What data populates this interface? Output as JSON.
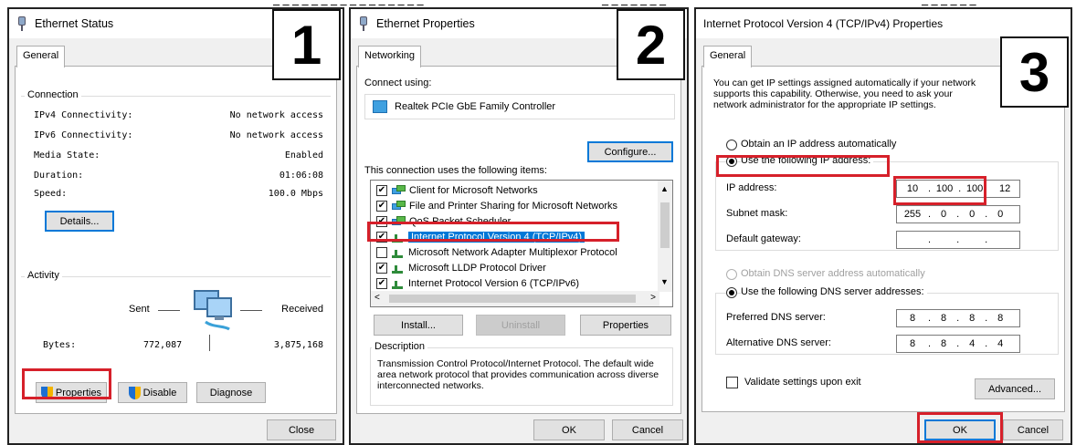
{
  "panels": {
    "status": {
      "window_title": "Ethernet Status",
      "step_number": "1",
      "tab": "General",
      "connection_group": "Connection",
      "rows": [
        {
          "label": "IPv4 Connectivity:",
          "value": "No network access"
        },
        {
          "label": "IPv6 Connectivity:",
          "value": "No network access"
        },
        {
          "label": "Media State:",
          "value": "Enabled"
        },
        {
          "label": "Duration:",
          "value": "01:06:08"
        },
        {
          "label": "Speed:",
          "value": "100.0 Mbps"
        }
      ],
      "details_button": "Details...",
      "activity_group": "Activity",
      "sent_label": "Sent",
      "received_label": "Received",
      "bytes_label": "Bytes:",
      "bytes_sent": "772,087",
      "bytes_received": "3,875,168",
      "properties_button": "Properties",
      "disable_button": "Disable",
      "diagnose_button": "Diagnose",
      "close_button": "Close"
    },
    "properties": {
      "window_title": "Ethernet Properties",
      "step_number": "2",
      "tab": "Networking",
      "connect_using_label": "Connect using:",
      "adapter_name": "Realtek PCIe GbE Family Controller",
      "configure_button": "Configure...",
      "items_label": "This connection uses the following items:",
      "items": [
        {
          "label": "Client for Microsoft Networks",
          "checked": true,
          "icon": "network-client-icon"
        },
        {
          "label": "File and Printer Sharing for Microsoft Networks",
          "checked": true,
          "icon": "network-client-icon"
        },
        {
          "label": "QoS Packet Scheduler",
          "checked": true,
          "icon": "network-client-icon"
        },
        {
          "label": "Internet Protocol Version 4 (TCP/IPv4)",
          "checked": true,
          "icon": "protocol-icon",
          "selected": true
        },
        {
          "label": "Microsoft Network Adapter Multiplexor Protocol",
          "checked": false,
          "icon": "protocol-icon"
        },
        {
          "label": "Microsoft LLDP Protocol Driver",
          "checked": true,
          "icon": "protocol-icon"
        },
        {
          "label": "Internet Protocol Version 6 (TCP/IPv6)",
          "checked": true,
          "icon": "protocol-icon"
        }
      ],
      "install_button": "Install...",
      "uninstall_button": "Uninstall",
      "properties_button": "Properties",
      "description_group": "Description",
      "description_text": "Transmission Control Protocol/Internet Protocol. The default wide area network protocol that provides communication across diverse interconnected networks.",
      "ok_button": "OK",
      "cancel_button": "Cancel"
    },
    "ipv4": {
      "window_title": "Internet Protocol Version 4 (TCP/IPv4) Properties",
      "step_number": "3",
      "tab": "General",
      "intro_text": "You can get IP settings assigned automatically if your network supports this capability. Otherwise, you need to ask your network administrator for the appropriate IP settings.",
      "obtain_ip_auto": "Obtain an IP address automatically",
      "use_following_ip": "Use the following IP address:",
      "ip_address_label": "IP address:",
      "ip_address": [
        "10",
        "100",
        "100",
        "12"
      ],
      "subnet_mask_label": "Subnet mask:",
      "subnet_mask": [
        "255",
        "0",
        "0",
        "0"
      ],
      "default_gateway_label": "Default gateway:",
      "default_gateway": [
        "",
        "",
        "",
        ""
      ],
      "obtain_dns_auto": "Obtain DNS server address automatically",
      "use_following_dns": "Use the following DNS server addresses:",
      "preferred_dns_label": "Preferred DNS server:",
      "preferred_dns": [
        "8",
        "8",
        "8",
        "8"
      ],
      "alternative_dns_label": "Alternative DNS server:",
      "alternative_dns": [
        "8",
        "8",
        "4",
        "4"
      ],
      "validate_label": "Validate settings upon exit",
      "advanced_button": "Advanced...",
      "ok_button": "OK",
      "cancel_button": "Cancel"
    }
  },
  "colors": {
    "highlight_box": "#d6202a",
    "selection": "#0078d7",
    "dialog_bg": "#f0f0f0"
  }
}
